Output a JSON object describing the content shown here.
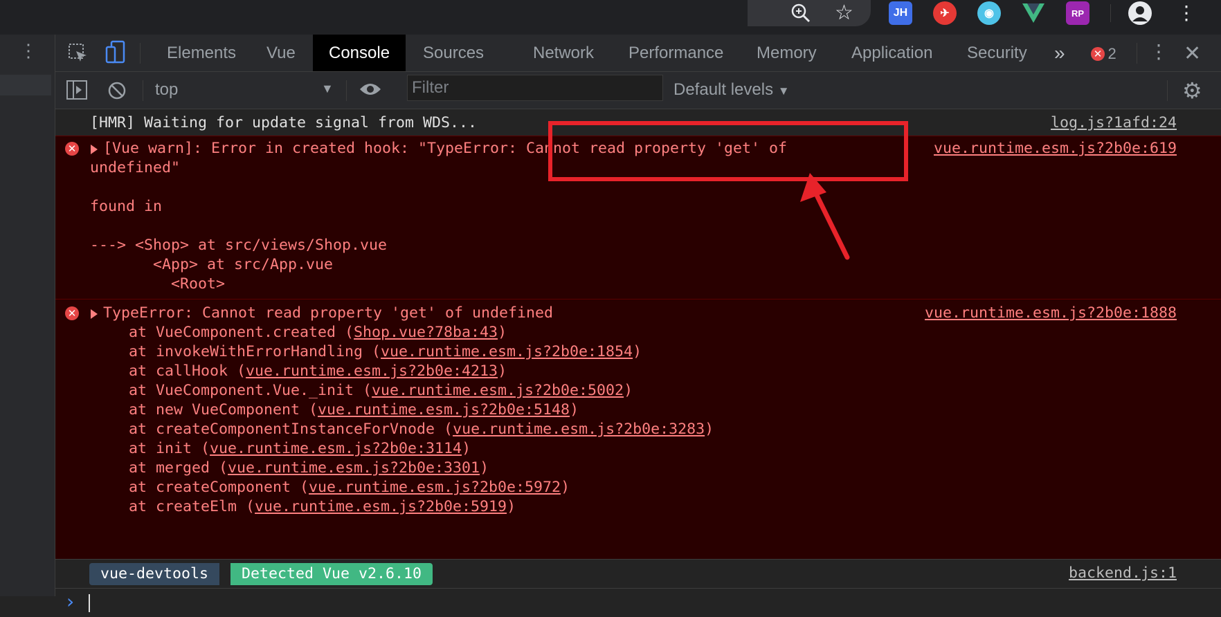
{
  "devtools": {
    "tabs": [
      "Elements",
      "Vue",
      "Console",
      "Sources",
      "Network",
      "Performance",
      "Memory",
      "Application",
      "Security"
    ],
    "active_tab": "Console",
    "more_tabs_label": "»",
    "error_count": "2"
  },
  "console_toolbar": {
    "context": "top",
    "filter_placeholder": "Filter",
    "levels": "Default levels"
  },
  "messages": [
    {
      "type": "log",
      "text": "[HMR] Waiting for update signal from WDS...",
      "source": "log.js?1afd:24"
    },
    {
      "type": "error",
      "lines": [
        "[Vue warn]: Error in created hook: \"TypeError: Cannot read property 'get' of",
        "undefined\"",
        "",
        "found in",
        "",
        "---> <Shop> at src/views/Shop.vue",
        "       <App> at src/App.vue",
        "         <Root>"
      ],
      "source": "vue.runtime.esm.js?2b0e:619"
    },
    {
      "type": "error",
      "headline": "TypeError: Cannot read property 'get' of undefined",
      "source": "vue.runtime.esm.js?2b0e:1888",
      "stack": [
        {
          "fn": "VueComponent.created",
          "loc": "Shop.vue?78ba:43"
        },
        {
          "fn": "invokeWithErrorHandling",
          "loc": "vue.runtime.esm.js?2b0e:1854"
        },
        {
          "fn": "callHook",
          "loc": "vue.runtime.esm.js?2b0e:4213"
        },
        {
          "fn": "VueComponent.Vue._init",
          "loc": "vue.runtime.esm.js?2b0e:5002"
        },
        {
          "fn": "new VueComponent",
          "loc": "vue.runtime.esm.js?2b0e:5148"
        },
        {
          "fn": "createComponentInstanceForVnode",
          "loc": "vue.runtime.esm.js?2b0e:3283"
        },
        {
          "fn": "init",
          "loc": "vue.runtime.esm.js?2b0e:3114"
        },
        {
          "fn": "merged",
          "loc": "vue.runtime.esm.js?2b0e:3301"
        },
        {
          "fn": "createComponent",
          "loc": "vue.runtime.esm.js?2b0e:5972"
        },
        {
          "fn": "createElm",
          "loc": "vue.runtime.esm.js?2b0e:5919"
        }
      ]
    },
    {
      "type": "badge",
      "label": "vue-devtools",
      "value": "Detected Vue v2.6.10",
      "source": "backend.js:1"
    }
  ],
  "prompt_symbol": "›",
  "extensions": [
    "JH",
    "RP"
  ],
  "colors": {
    "error_text": "#ff8080",
    "error_bg": "#290000",
    "annotation": "#e8232a",
    "vue_dark": "#35495e",
    "vue_green": "#41b883"
  }
}
